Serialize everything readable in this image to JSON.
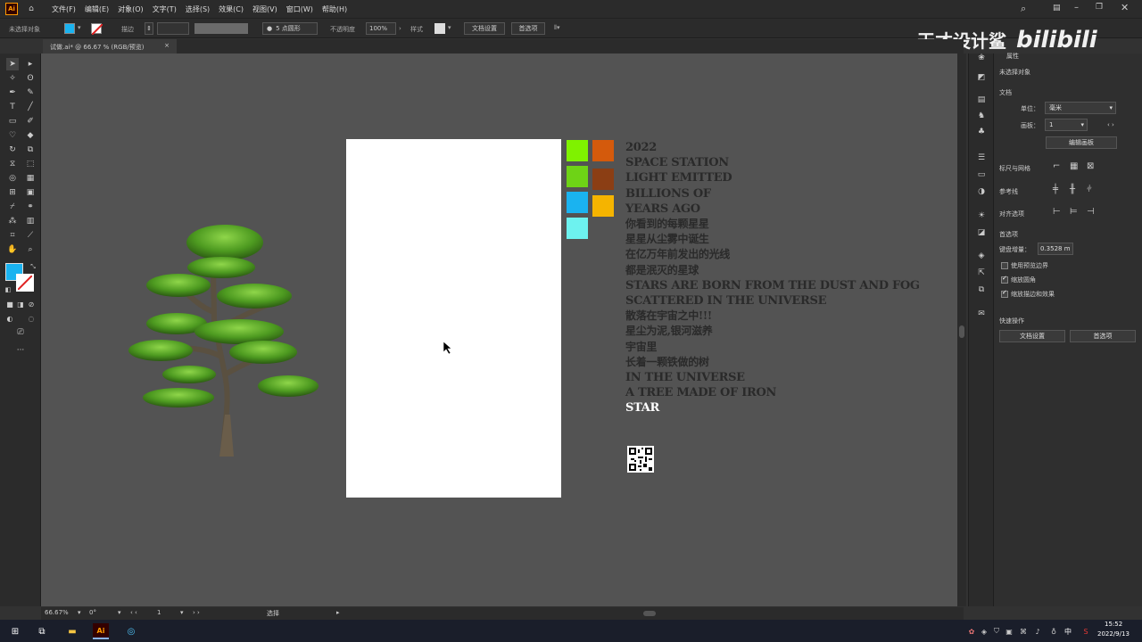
{
  "menubar": {
    "logo": "Ai",
    "items": [
      "文件(F)",
      "编辑(E)",
      "对象(O)",
      "文字(T)",
      "选择(S)",
      "效果(C)",
      "视图(V)",
      "窗口(W)",
      "帮助(H)"
    ]
  },
  "control": {
    "selection_label": "未选择对象",
    "stroke_label": "描边",
    "brush_label": "5 点圆形",
    "opacity_label": "不透明度",
    "opacity_value": "100%",
    "style_label": "样式",
    "doc_setup": "文档设置",
    "preferences": "首选项"
  },
  "tab": {
    "label": "试做.ai* @ 66.67 % (RGB/预览)",
    "close": "×"
  },
  "watermark": {
    "text": "天才设计鲨",
    "brand": "bilibili"
  },
  "artwork": {
    "color_swatches": [
      "#7ff200",
      "#d45a0c",
      "#6ed316",
      "#8b3e14",
      "#1ab3f0",
      "#f5b400",
      "#6df2ef"
    ],
    "text_lines": [
      {
        "t": "2022",
        "zh": false
      },
      {
        "t": "SPACE STATION",
        "zh": false
      },
      {
        "t": "LIGHT EMITTED",
        "zh": false
      },
      {
        "t": "BILLIONS OF",
        "zh": false
      },
      {
        "t": "YEARS AGO",
        "zh": false
      },
      {
        "t": "你看到的每颗星星",
        "zh": true
      },
      {
        "t": "星星从尘雾中诞生",
        "zh": true
      },
      {
        "t": "在亿万年前发出的光线",
        "zh": true
      },
      {
        "t": "都是泯灭的星球",
        "zh": true
      },
      {
        "t": "STARS ARE BORN FROM THE DUST AND FOG",
        "zh": false
      },
      {
        "t": "SCATTERED IN THE UNIVERSE",
        "zh": false
      },
      {
        "t": "散落在宇宙之中!!!",
        "zh": true
      },
      {
        "t": "星尘为泥,银河滋养",
        "zh": true
      },
      {
        "t": "宇宙里",
        "zh": true
      },
      {
        "t": "长着一颗铁做的树",
        "zh": true
      },
      {
        "t": "IN THE UNIVERSE",
        "zh": false
      },
      {
        "t": "A TREE MADE OF IRON",
        "zh": false
      },
      {
        "t": "STAR",
        "zh": false,
        "white": true
      }
    ]
  },
  "properties": {
    "title": "属性",
    "no_selection": "未选择对象",
    "document": "文档",
    "unit_label": "单位：",
    "unit_value": "毫米",
    "artboard_label": "画板：",
    "artboard_value": "1",
    "edit_artboard": "编辑画板",
    "rulers_grids": "标尺与网格",
    "guides": "参考线",
    "align_options": "对齐选项",
    "prefs": "首选项",
    "keyboard_increment_label": "键盘增量：",
    "keyboard_increment_value": "0.3528 m",
    "use_preview_bounds": "使用预览边界",
    "scale_corners": "缩放圆角",
    "scale_strokes": "缩放描边和效果",
    "quick_actions": "快速操作",
    "doc_setup_btn": "文档设置",
    "prefs_btn": "首选项"
  },
  "status": {
    "zoom": "66.67%",
    "rotation": "0°",
    "artboard_num": "1",
    "tool": "选择"
  },
  "taskbar": {
    "time": "15:52",
    "date": "2022/9/13",
    "ime": "中"
  }
}
